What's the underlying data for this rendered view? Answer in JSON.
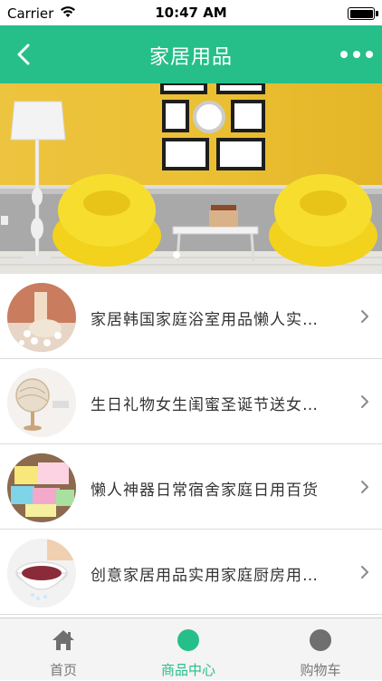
{
  "status_bar": {
    "carrier": "Carrier",
    "time": "10:47 AM"
  },
  "nav": {
    "title": "家居用品",
    "back_icon": "chevron-left-icon",
    "more_icon": "more-dots-icon"
  },
  "banner": {
    "page_count": 3,
    "active_page": 1
  },
  "products": [
    {
      "title": "家居韩国家庭浴室用品懒人实…"
    },
    {
      "title": "生日礼物女生闺蜜圣诞节送女…"
    },
    {
      "title": "懒人神器日常宿舍家庭日用百货"
    },
    {
      "title": "创意家居用品实用家庭厨房用…"
    }
  ],
  "tabs": [
    {
      "label": "首页",
      "icon": "home-icon"
    },
    {
      "label": "商品中心",
      "icon": "circle-icon",
      "active": true
    },
    {
      "label": "购物车",
      "icon": "circle-icon"
    }
  ],
  "colors": {
    "accent": "#26bf8a",
    "tab_inactive": "#777777",
    "icon_inactive": "#6f6f6f"
  }
}
